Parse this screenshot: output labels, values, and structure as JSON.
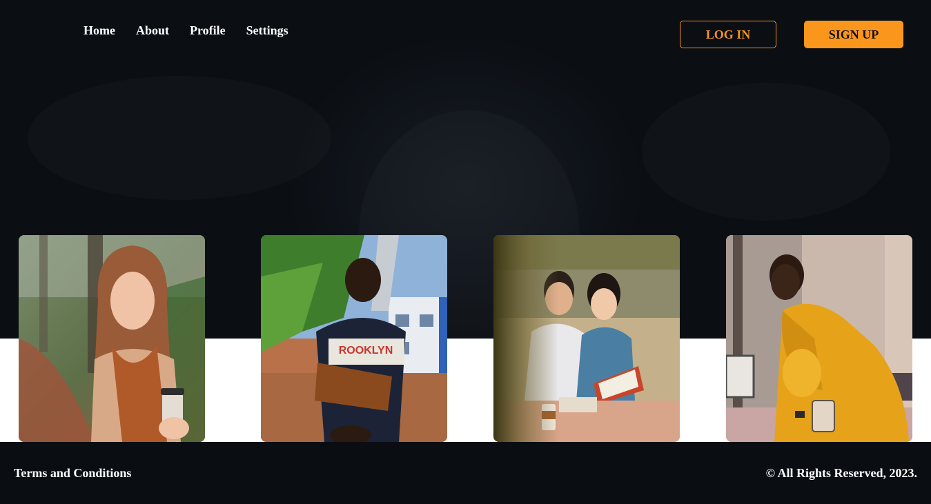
{
  "nav": {
    "items": [
      {
        "label": "Home"
      },
      {
        "label": "About"
      },
      {
        "label": "Profile"
      },
      {
        "label": "Settings"
      }
    ]
  },
  "auth": {
    "login_label": "LOG IN",
    "signup_label": "SIGN UP"
  },
  "colors": {
    "accent": "#fb961d",
    "background": "#0a0e13",
    "band": "#ffffff"
  },
  "gallery": {
    "photos": [
      {
        "subject": "woman-with-scarf-and-coffee"
      },
      {
        "subject": "man-with-shoulder-bag"
      },
      {
        "subject": "couple-reading-book"
      },
      {
        "subject": "woman-in-yellow-dress"
      }
    ]
  },
  "footer": {
    "terms_label": "Terms and Conditions",
    "copyright": "© All Rights Reserved, 2023."
  }
}
